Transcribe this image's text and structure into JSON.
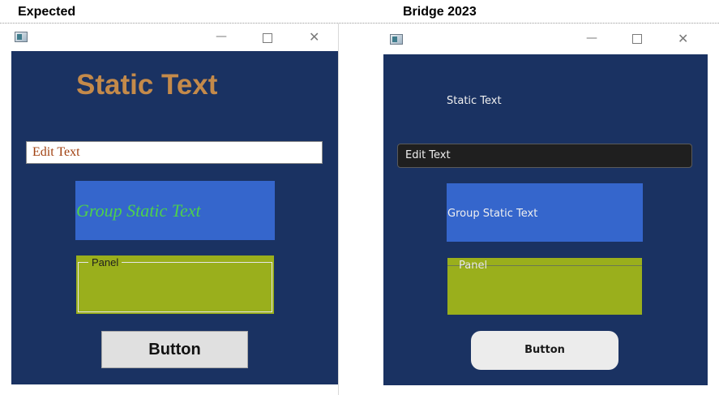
{
  "headings": {
    "left": "Expected",
    "right": "Bridge 2023"
  },
  "window_controls": {
    "minimize": "—",
    "close": "✕"
  },
  "icons": {
    "app": "app-window-icon",
    "minimize": "minimize-icon",
    "maximize": "maximize-icon",
    "close": "close-icon"
  },
  "expected": {
    "static_text": "Static Text",
    "edit_text": "Edit Text",
    "group_static_text": "Group Static Text",
    "panel_label": "Panel",
    "button_label": "Button"
  },
  "bridge": {
    "static_text": "Static Text",
    "edit_text": "Edit Text",
    "group_static_text": "Group Static Text",
    "panel_label": "Panel",
    "button_label": "Button"
  },
  "colors": {
    "dialog_bg": "#1a3262",
    "group_bg": "#3566cc",
    "panel_bg": "#9aaf1c",
    "expected_static_text": "#c48a4a",
    "expected_edit_text": "#a04010",
    "expected_group_text": "#4dd04d"
  }
}
